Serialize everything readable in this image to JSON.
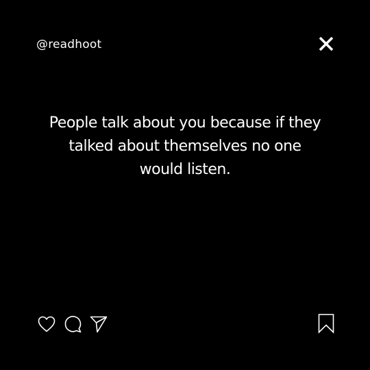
{
  "post": {
    "handle": "@readhoot",
    "quote": "People talk about you because if they talked about themselves no one would listen."
  },
  "icons": {
    "close": "close-icon",
    "like": "heart-icon",
    "comment": "comment-icon",
    "share": "send-icon",
    "save": "bookmark-icon"
  },
  "colors": {
    "background": "#000000",
    "text": "#ffffff"
  }
}
